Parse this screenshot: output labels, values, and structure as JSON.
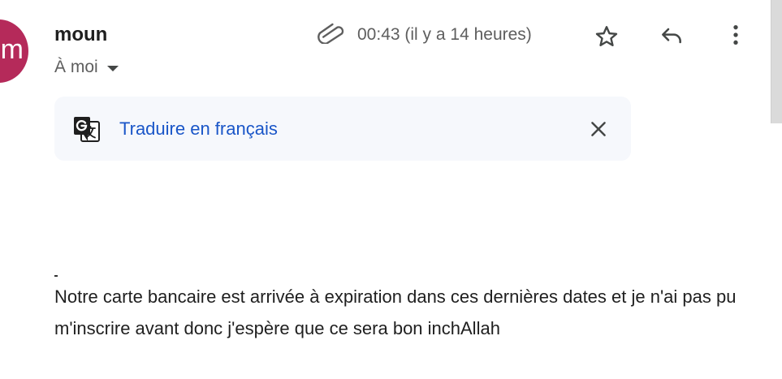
{
  "sender": {
    "avatar_letter": "m",
    "avatar_color": "#b52a5a",
    "name": "moun",
    "recipient_label": "À moi"
  },
  "header": {
    "timestamp": "00:43 (il y a 14 heures)",
    "has_attachment_icon": "paperclip-icon",
    "star_icon": "star-icon",
    "reply_icon": "reply-icon",
    "more_icon": "more-vert-icon"
  },
  "translate_bar": {
    "icon": "google-translate-icon",
    "link_label": "Traduire en français",
    "close_icon": "close-icon",
    "link_color": "#1a56c8"
  },
  "message": {
    "body": "Notre carte bancaire est arrivée à expiration dans ces dernières dates et je n'ai pas pu m'inscrire avant donc j'espère que ce sera bon inchAllah"
  }
}
